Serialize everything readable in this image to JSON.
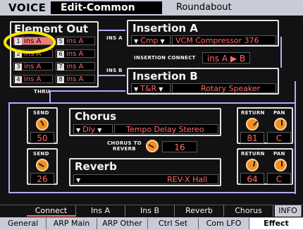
{
  "header": {
    "section": "VOICE",
    "mode": "Edit-Common",
    "voice_name": "Roundabout"
  },
  "element_out": {
    "title": "Element Out",
    "cells": [
      {
        "n": "1",
        "v": "ins A",
        "selected": true
      },
      {
        "n": "5",
        "v": "ins A"
      },
      {
        "n": "2",
        "v": "ins A"
      },
      {
        "n": "6",
        "v": "ins A"
      },
      {
        "n": "3",
        "v": "ins A"
      },
      {
        "n": "7",
        "v": "ins A"
      },
      {
        "n": "4",
        "v": "ins A"
      },
      {
        "n": "8",
        "v": "ins A"
      }
    ]
  },
  "labels": {
    "ins_a": "INS A",
    "ins_b": "INS B",
    "thru": "THRU",
    "insertion_connect": "INSERTION CONNECT",
    "chorus_to_reverb": "CHORUS TO\nREVERB"
  },
  "insertion_a": {
    "title": "Insertion A",
    "category": "Cmp",
    "effect": "VCM Compressor 376"
  },
  "insertion_connect": {
    "value": "ins A ▶ B"
  },
  "insertion_b": {
    "title": "Insertion B",
    "category": "T&R",
    "effect": "Rotary Speaker"
  },
  "chorus": {
    "title": "Chorus",
    "category": "Dly",
    "effect": "Tempo Delay Stereo",
    "send_label": "SEND",
    "send_value": "50",
    "return_label": "RETURN",
    "return_value": "81",
    "pan_label": "PAN",
    "pan_value": "C",
    "to_reverb_value": "16"
  },
  "reverb": {
    "title": "Reverb",
    "effect": "REV-X Hall",
    "send_label": "SEND",
    "send_value": "26",
    "return_label": "RETURN",
    "return_value": "64",
    "pan_label": "PAN",
    "pan_value": "C"
  },
  "tabs_top": [
    "Connect",
    "Ins A",
    "Ins B",
    "Reverb",
    "Chorus",
    "INFO"
  ],
  "tabs_bottom": [
    "General",
    "ARP Main",
    "ARP Other",
    "Ctrl Set",
    "Com LFO",
    "Effect"
  ],
  "colors": {
    "accent": "#ff6a6a",
    "knob": "#f09020",
    "flow_line": "#b9a9ff",
    "highlight": "#ffe600"
  }
}
